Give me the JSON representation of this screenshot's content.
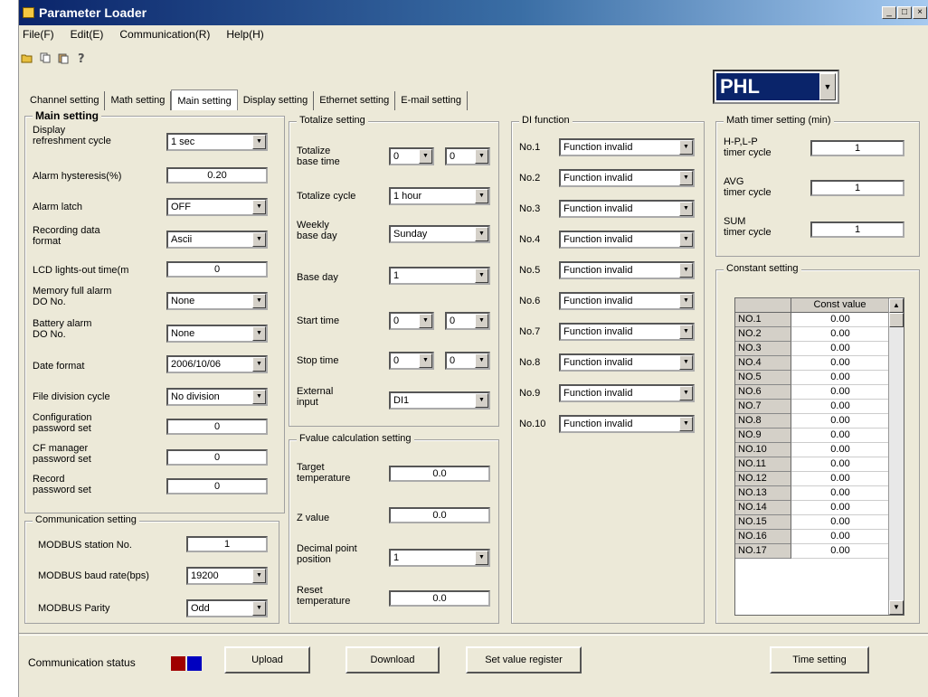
{
  "window": {
    "title": "Parameter Loader"
  },
  "menu": [
    "File(F)",
    "Edit(E)",
    "Communication(R)",
    "Help(H)"
  ],
  "tabs": [
    "Channel setting",
    "Math setting",
    "Main setting",
    "Display setting",
    "Ethernet setting",
    "E-mail setting"
  ],
  "model_select": "PHL",
  "main_setting": {
    "title": "Main setting",
    "display_refresh_label": "Display\nrefreshment cycle",
    "display_refresh_value": "1 sec",
    "alarm_hysteresis_label": "Alarm hysteresis(%)",
    "alarm_hysteresis_value": "0.20",
    "alarm_latch_label": "Alarm latch",
    "alarm_latch_value": "OFF",
    "recording_format_label": "Recording data\nformat",
    "recording_format_value": "Ascii",
    "lcd_lights_label": "LCD lights-out time(m",
    "lcd_lights_value": "0",
    "memory_full_label": "Memory full alarm\nDO No.",
    "memory_full_value": "None",
    "battery_alarm_label": "Battery alarm\nDO No.",
    "battery_alarm_value": "None",
    "date_format_label": "Date format",
    "date_format_value": "2006/10/06",
    "file_division_label": "File division cycle",
    "file_division_value": "No division",
    "config_pw_label": "Configuration\npassword set",
    "config_pw_value": "0",
    "cf_pw_label": "CF manager\npassword set",
    "cf_pw_value": "0",
    "record_pw_label": "Record\npassword set",
    "record_pw_value": "0"
  },
  "communication_setting": {
    "title": "Communication setting",
    "station_label": "MODBUS station No.",
    "station_value": "1",
    "baud_label": "MODBUS baud rate(bps)",
    "baud_value": "19200",
    "parity_label": "MODBUS Parity",
    "parity_value": "Odd"
  },
  "totalize_setting": {
    "title": "Totalize setting",
    "base_time_label": "Totalize\nbase time",
    "base_time_h": "0",
    "base_time_m": "0",
    "cycle_label": "Totalize cycle",
    "cycle_value": "1 hour",
    "weekly_label": "Weekly\nbase day",
    "weekly_value": "Sunday",
    "base_day_label": "Base day",
    "base_day_value": "1",
    "start_label": "Start time",
    "start_h": "0",
    "start_m": "0",
    "stop_label": "Stop time",
    "stop_h": "0",
    "stop_m": "0",
    "ext_label": "External\ninput",
    "ext_value": "DI1"
  },
  "fvalue_setting": {
    "title": "Fvalue calculation setting",
    "target_label": "Target\ntemperature",
    "target_value": "0.0",
    "z_label": "Z value",
    "z_value": "0.0",
    "decimal_label": "Decimal point\nposition",
    "decimal_value": "1",
    "reset_label": "Reset\ntemperature",
    "reset_value": "0.0"
  },
  "di_function": {
    "title": "DI function",
    "items": [
      {
        "label": "No.1",
        "value": "Function invalid"
      },
      {
        "label": "No.2",
        "value": "Function invalid"
      },
      {
        "label": "No.3",
        "value": "Function invalid"
      },
      {
        "label": "No.4",
        "value": "Function invalid"
      },
      {
        "label": "No.5",
        "value": "Function invalid"
      },
      {
        "label": "No.6",
        "value": "Function invalid"
      },
      {
        "label": "No.7",
        "value": "Function invalid"
      },
      {
        "label": "No.8",
        "value": "Function invalid"
      },
      {
        "label": "No.9",
        "value": "Function invalid"
      },
      {
        "label": "No.10",
        "value": "Function invalid"
      }
    ]
  },
  "math_timer": {
    "title": "Math timer setting (min)",
    "hpl_label": "H-P,L-P\ntimer cycle",
    "hpl_value": "1",
    "avg_label": "AVG\ntimer cycle",
    "avg_value": "1",
    "sum_label": "SUM\ntimer cycle",
    "sum_value": "1"
  },
  "constant_setting": {
    "title": "Constant setting",
    "col_header": "Const value",
    "rows": [
      {
        "label": "NO.1",
        "value": "0.00"
      },
      {
        "label": "NO.2",
        "value": "0.00"
      },
      {
        "label": "NO.3",
        "value": "0.00"
      },
      {
        "label": "NO.4",
        "value": "0.00"
      },
      {
        "label": "NO.5",
        "value": "0.00"
      },
      {
        "label": "NO.6",
        "value": "0.00"
      },
      {
        "label": "NO.7",
        "value": "0.00"
      },
      {
        "label": "NO.8",
        "value": "0.00"
      },
      {
        "label": "NO.9",
        "value": "0.00"
      },
      {
        "label": "NO.10",
        "value": "0.00"
      },
      {
        "label": "NO.11",
        "value": "0.00"
      },
      {
        "label": "NO.12",
        "value": "0.00"
      },
      {
        "label": "NO.13",
        "value": "0.00"
      },
      {
        "label": "NO.14",
        "value": "0.00"
      },
      {
        "label": "NO.15",
        "value": "0.00"
      },
      {
        "label": "NO.16",
        "value": "0.00"
      },
      {
        "label": "NO.17",
        "value": "0.00"
      }
    ]
  },
  "footer": {
    "comm_status_label": "Communication status",
    "status_colors": [
      "#a00000",
      "#0000c0"
    ],
    "upload": "Upload",
    "download": "Download",
    "set_value_register": "Set value register",
    "time_setting": "Time setting"
  }
}
